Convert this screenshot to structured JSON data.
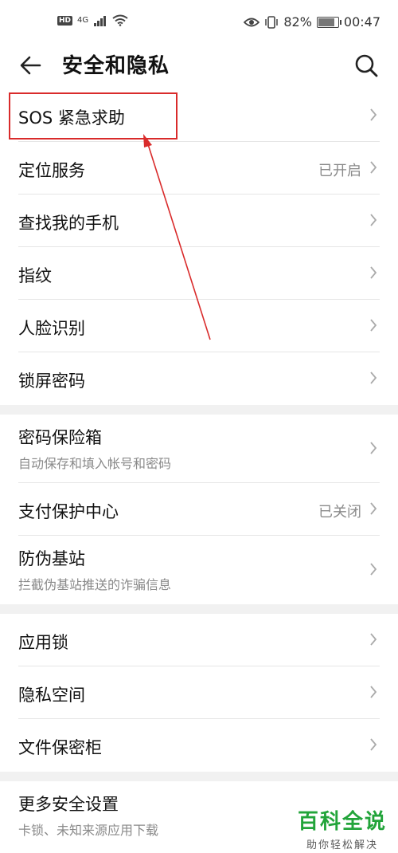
{
  "status": {
    "hd_badge": "HD",
    "network": "4G",
    "battery": "82%",
    "battery_level": 0.82,
    "time": "00:47"
  },
  "header": {
    "title": "安全和隐私"
  },
  "items": [
    {
      "label": "SOS 紧急求助"
    },
    {
      "label": "定位服务",
      "value": "已开启"
    },
    {
      "label": "查找我的手机"
    },
    {
      "label": "指纹"
    },
    {
      "label": "人脸识别"
    },
    {
      "label": "锁屏密码"
    },
    {
      "label": "密码保险箱",
      "subtitle": "自动保存和填入帐号和密码"
    },
    {
      "label": "支付保护中心",
      "value": "已关闭"
    },
    {
      "label": "防伪基站",
      "subtitle": "拦截伪基站推送的诈骗信息"
    },
    {
      "label": "应用锁"
    },
    {
      "label": "隐私空间"
    },
    {
      "label": "文件保密柜"
    },
    {
      "label": "更多安全设置",
      "subtitle": "卡锁、未知来源应用下载"
    }
  ],
  "watermark": {
    "title": "百科全说",
    "subtitle": "助你轻松解决"
  },
  "colors": {
    "annotation": "#d92b2b",
    "watermark": "#22a43a"
  }
}
